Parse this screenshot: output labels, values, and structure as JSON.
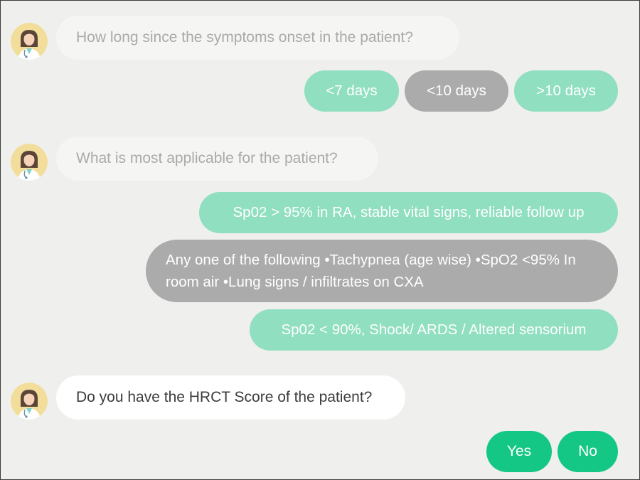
{
  "colors": {
    "background": "#efefed",
    "option_faded": "#8fdfc0",
    "option_selected": "#ababab",
    "option_active": "#14c785",
    "bubble_inactive_text": "#aaaaaa",
    "bubble_active_text": "#3c3c3c"
  },
  "avatar_icon": "doctor-avatar-icon",
  "chat": [
    {
      "question": "How long since the symptoms onset in the patient?",
      "options": [
        "<7 days",
        "<10 days",
        ">10 days"
      ],
      "selected": "<10 days"
    },
    {
      "question": "What is most applicable for the patient?",
      "options": [
        "Sp02 > 95% in RA, stable vital signs, reliable follow up",
        "Any one of the following •Tachypnea (age wise) •SpO2 <95% In room air •Lung signs / infiltrates on CXA",
        "Sp02 < 90%, Shock/ ARDS / Altered sensorium"
      ],
      "selected": "Any one of the following •Tachypnea (age wise) •SpO2 <95% In room air •Lung signs / infiltrates on CXA"
    },
    {
      "question": "Do you have the HRCT Score of the patient?",
      "options": [
        "Yes",
        "No"
      ],
      "selected": null
    }
  ]
}
